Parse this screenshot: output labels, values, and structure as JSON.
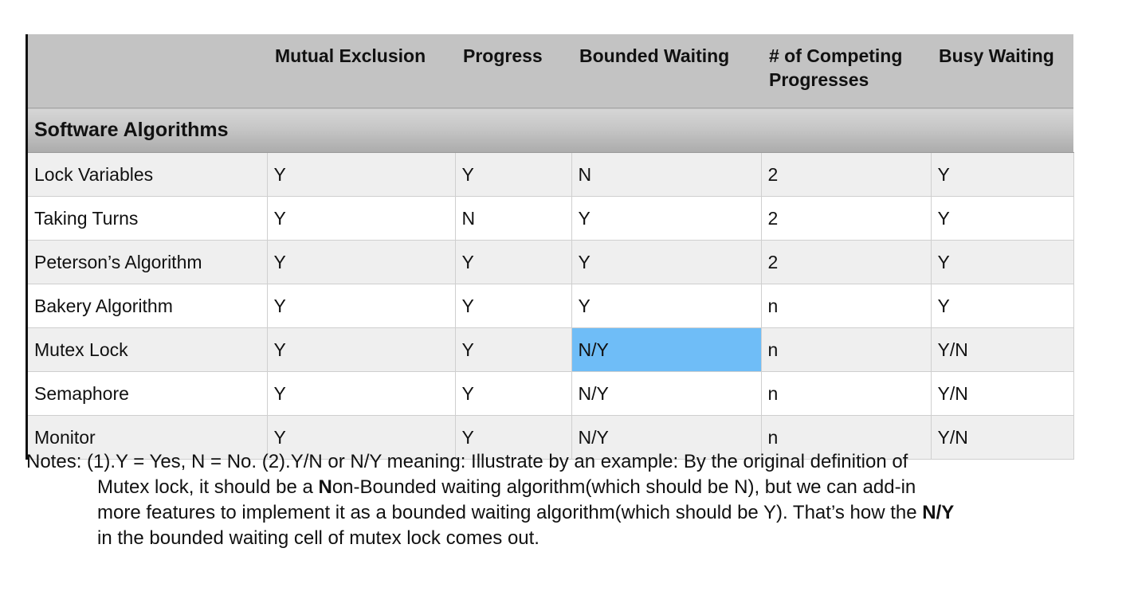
{
  "table": {
    "columns": [
      "",
      "Mutual Exclusion",
      "Progress",
      "Bounded Waiting",
      "# of Competing Progresses",
      "Busy Waiting"
    ],
    "section_title": "Software Algorithms",
    "rows": [
      {
        "name": "Lock Variables",
        "cells": [
          "Y",
          "Y",
          "N",
          "2",
          "Y"
        ]
      },
      {
        "name": "Taking Turns",
        "cells": [
          "Y",
          "N",
          "Y",
          "2",
          "Y"
        ]
      },
      {
        "name": "Peterson’s Algorithm",
        "cells": [
          "Y",
          "Y",
          "Y",
          "2",
          "Y"
        ]
      },
      {
        "name": "Bakery Algorithm",
        "cells": [
          "Y",
          "Y",
          "Y",
          "n",
          "Y"
        ]
      },
      {
        "name": "Mutex Lock",
        "cells": [
          "Y",
          "Y",
          "N/Y",
          "n",
          "Y/N"
        ]
      },
      {
        "name": "Semaphore",
        "cells": [
          "Y",
          "Y",
          "N/Y",
          "n",
          "Y/N"
        ]
      },
      {
        "name": "Monitor",
        "cells": [
          "Y",
          "Y",
          "N/Y",
          "n",
          "Y/N"
        ]
      }
    ],
    "highlight_color": "#6fbdf7"
  },
  "notes": {
    "line1": "Notes: (1).Y = Yes, N = No.   (2).Y/N or N/Y meaning: Illustrate by an example: By the original definition of",
    "line2_pre": "Mutex lock, it should be a ",
    "line2_bold": "N",
    "line2_post": "on-Bounded waiting algorithm(which should be N), but we can add-in",
    "line3_pre": "more features to implement it as a bounded waiting algorithm(which should be Y). That’s how the ",
    "line3_bold": "N/Y",
    "line4": "in the bounded waiting cell of mutex lock comes out."
  }
}
